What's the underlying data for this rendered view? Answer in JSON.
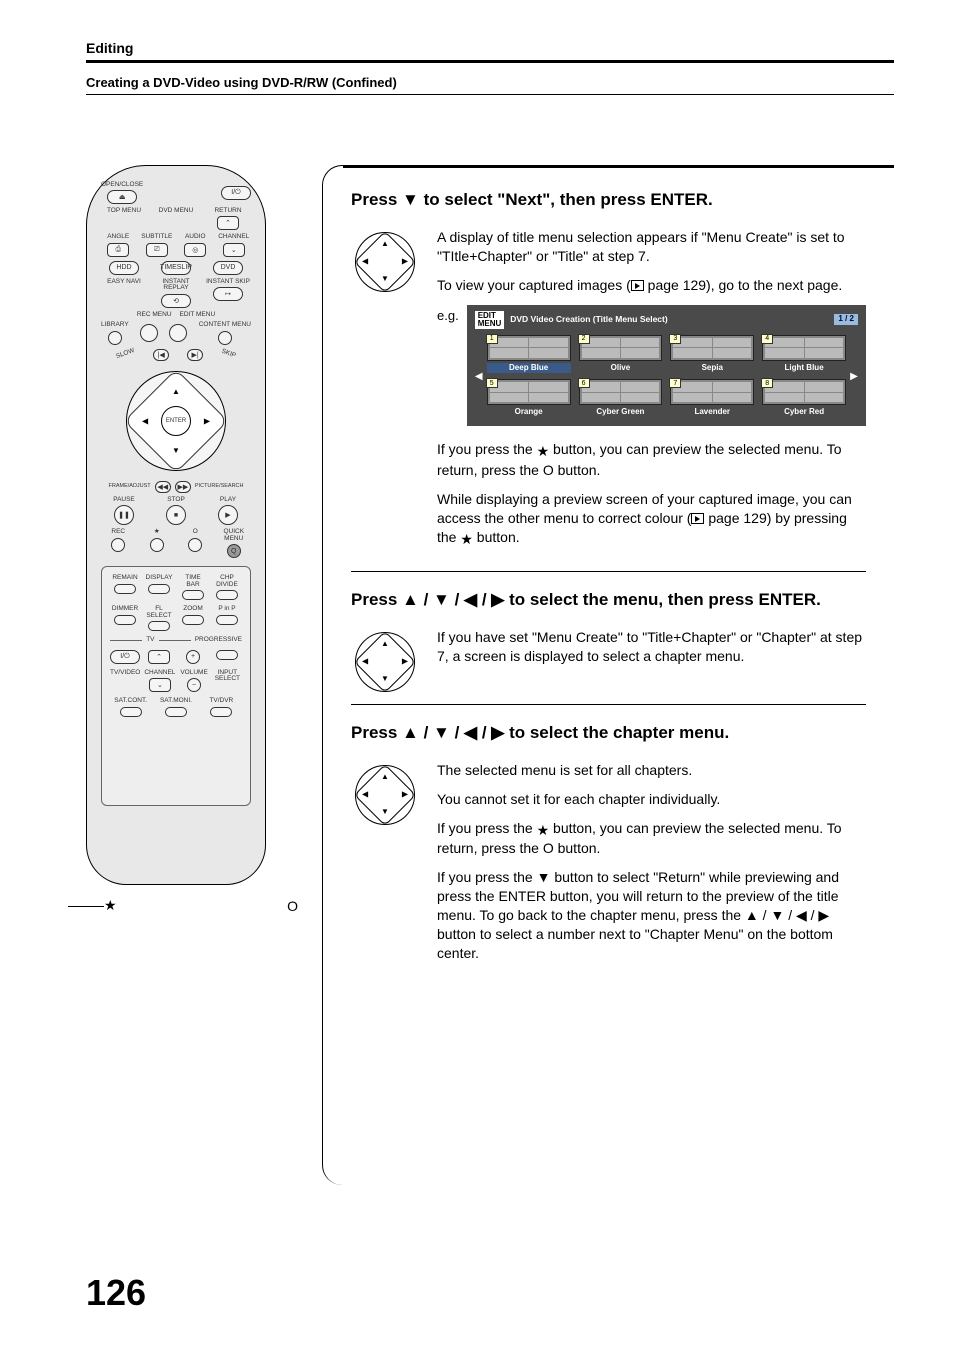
{
  "header": {
    "section": "Editing",
    "subtitle": "Creating a DVD-Video using DVD-R/RW (Confined)"
  },
  "page_number": "126",
  "remote": {
    "open_close": "OPEN/CLOSE",
    "eject_icon": "⏏",
    "power_icon": "I/⏻",
    "top_menu": "TOP MENU",
    "dvd_menu": "DVD MENU",
    "return": "RETURN",
    "angle": "ANGLE",
    "subtitle": "SUBTITLE",
    "audio": "AUDIO",
    "channel": "CHANNEL",
    "hdd": "HDD",
    "timeslip": "TIMESLIP",
    "dvd": "DVD",
    "easy_navi": "EASY NAVI",
    "instant_replay": "INSTANT REPLAY",
    "instant_skip": "INSTANT SKIP",
    "rec_menu": "REC MENU",
    "edit_menu": "EDIT MENU",
    "library": "LIBRARY",
    "content_menu": "CONTENT MENU",
    "slow": "SLOW",
    "skip": "SKIP",
    "frame_adjust": "FRAME/ADJUST",
    "picture_search": "PICTURE/SEARCH",
    "enter": "ENTER",
    "pause": "PAUSE",
    "stop": "STOP",
    "play": "PLAY",
    "rec": "REC",
    "star": "★",
    "circle": "O",
    "quick_menu": "QUICK MENU",
    "remain": "REMAIN",
    "display": "DISPLAY",
    "time_bar": "TIME BAR",
    "chp_divide": "CHP DIVIDE",
    "dimmer": "DIMMER",
    "fl_select": "FL SELECT",
    "zoom": "ZOOM",
    "pinp": "P in P",
    "tv": "TV",
    "progressive": "PROGRESSIVE",
    "tv_video": "TV/VIDEO",
    "channel2": "CHANNEL",
    "volume": "VOLUME",
    "input_select": "INPUT SELECT",
    "sat_cont": "SAT.CONT.",
    "sat_moni": "SAT.MONI.",
    "tv_dvr": "TV/DVR"
  },
  "footer_symbols": {
    "star": "★",
    "circle": "O"
  },
  "step1": {
    "title_pre": "Press ",
    "title_arrow": "▼",
    "title_mid": " to select \"Next\", then press ENTER.",
    "p1": "A display of title menu selection appears if \"Menu Create\" is set to \"TItle+Chapter\" or \"Title\" at step 7.",
    "p2_pre": "To view your captured images (",
    "p2_page": " page 129), go to the next page.",
    "eg_label": "e.g.",
    "screenshot": {
      "edit_badge_top": "EDIT",
      "edit_badge_bottom": "MENU",
      "title": "DVD Video Creation (Title Menu Select)",
      "page": "1 / 2",
      "thumbs_row1": [
        {
          "num": "1",
          "label": "Deep Blue",
          "selected": true
        },
        {
          "num": "2",
          "label": "Olive",
          "selected": false
        },
        {
          "num": "3",
          "label": "Sepia",
          "selected": false
        },
        {
          "num": "4",
          "label": "Light Blue",
          "selected": false
        }
      ],
      "thumbs_row2": [
        {
          "num": "5",
          "label": "Orange",
          "selected": false
        },
        {
          "num": "6",
          "label": "Cyber Green",
          "selected": false
        },
        {
          "num": "7",
          "label": "Lavender",
          "selected": false
        },
        {
          "num": "8",
          "label": "Cyber Red",
          "selected": false
        }
      ]
    },
    "p3_pre": "If you press the ",
    "p3_star": "★",
    "p3_post": " button, you can preview the selected menu. To return, press the O button.",
    "p4_pre": "While displaying a preview screen of your captured image, you can access the other menu to correct colour (",
    "p4_page": " page 129) by pressing the ",
    "p4_star": "★",
    "p4_post": " button."
  },
  "step2": {
    "title_pre": "Press ",
    "title_arrows": "▲ / ▼ / ◀ / ▶",
    "title_post": " to select the menu, then press ENTER.",
    "p1": "If you have set \"Menu Create\" to \"Title+Chapter\" or \"Chapter\" at step 7, a screen is displayed to select a chapter menu."
  },
  "step3": {
    "title_pre": "Press ",
    "title_arrows": "▲ / ▼ / ◀ / ▶",
    "title_post": " to select the chapter menu.",
    "p1": "The selected menu is set for all chapters.",
    "p2": "You cannot set it for each chapter individually.",
    "p3_pre": "If you press the ",
    "p3_star": "★",
    "p3_post": " button, you can preview the selected menu. To return, press the O button.",
    "p4": "If you press the ▼ button to select \"Return\" while previewing and press the ENTER button, you will return to the preview of the title menu. To go back to the chapter menu, press the ▲ / ▼ / ◀ / ▶ button to select a number next to \"Chapter Menu\" on the bottom center."
  },
  "enter_label": "ENTER"
}
